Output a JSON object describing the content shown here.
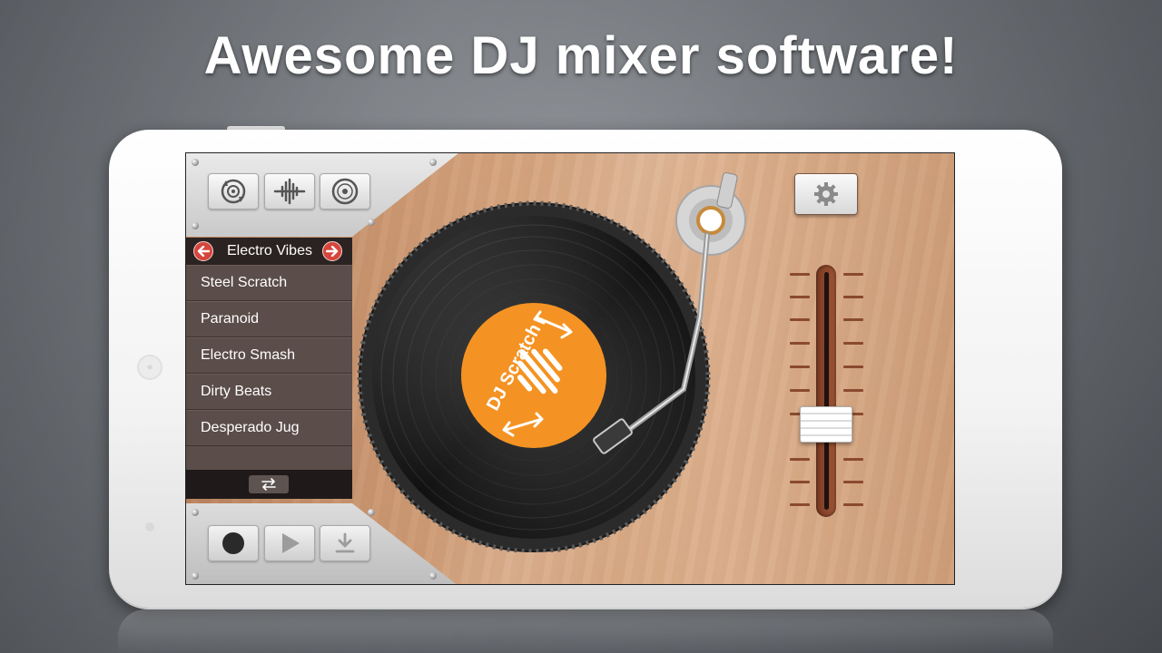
{
  "headline": "Awesome DJ mixer software!",
  "modes": [
    {
      "name": "turntable-mode",
      "icon": "record-sync-icon"
    },
    {
      "name": "waveform-mode",
      "icon": "waveform-icon"
    },
    {
      "name": "vinyl-mode",
      "icon": "vinyl-icon"
    }
  ],
  "playlist": {
    "title": "Electro Vibes",
    "prev_icon": "arrow-left-icon",
    "next_icon": "arrow-right-icon",
    "items": [
      "Steel Scratch",
      "Paranoid",
      "Electro Smash",
      "Dirty Beats",
      "Desperado Jug"
    ],
    "swap_icon": "swap-icon"
  },
  "record_label": {
    "text": "DJ Scratch",
    "color": "#f49323"
  },
  "transport": [
    {
      "name": "record",
      "icon": "record-icon"
    },
    {
      "name": "play",
      "icon": "play-icon"
    },
    {
      "name": "download",
      "icon": "download-icon"
    }
  ],
  "settings_icon": "gear-icon",
  "pitch_fader": {
    "level": 0.35
  }
}
